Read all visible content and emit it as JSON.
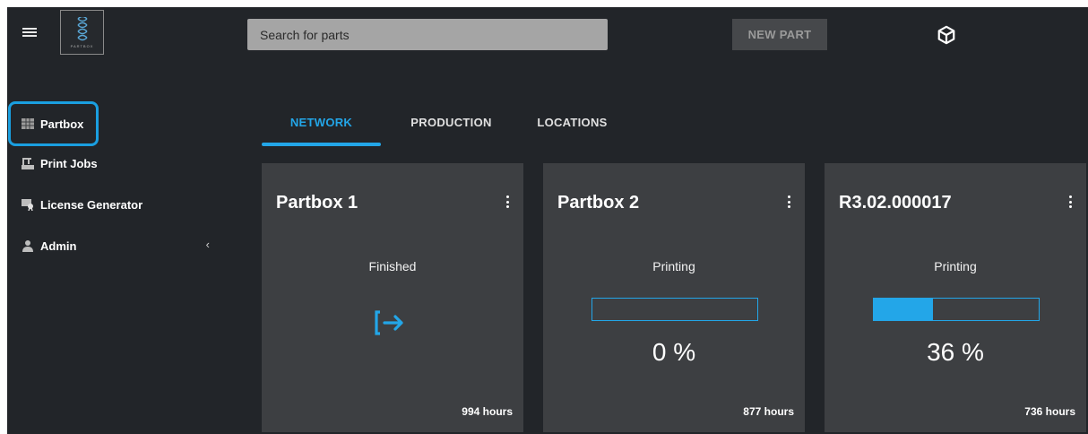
{
  "header": {
    "logo_word": "PARTBOX",
    "search_placeholder": "Search for parts",
    "new_part_label": "NEW PART"
  },
  "sidebar": {
    "items": [
      {
        "label": "Partbox",
        "icon": "box-icon",
        "active": true
      },
      {
        "label": "Print Jobs",
        "icon": "printer-icon"
      },
      {
        "label": "License Generator",
        "icon": "certificate-icon"
      },
      {
        "label": "Admin",
        "icon": "user-icon",
        "expandable": true
      }
    ]
  },
  "tabs": [
    {
      "label": "NETWORK",
      "active": true
    },
    {
      "label": "PRODUCTION"
    },
    {
      "label": "LOCATIONS"
    }
  ],
  "cards": [
    {
      "title": "Partbox 1",
      "status": "Finished",
      "hours": "994 hours",
      "progress": null
    },
    {
      "title": "Partbox 2",
      "status": "Printing",
      "percent": "0 %",
      "progress": 0,
      "hours": "877 hours"
    },
    {
      "title": "R3.02.000017",
      "status": "Printing",
      "percent": "36 %",
      "progress": 0.36,
      "hours": "736 hours"
    }
  ],
  "colors": {
    "accent": "#23a6e8",
    "background": "#222529",
    "card": "#3d3f42"
  }
}
